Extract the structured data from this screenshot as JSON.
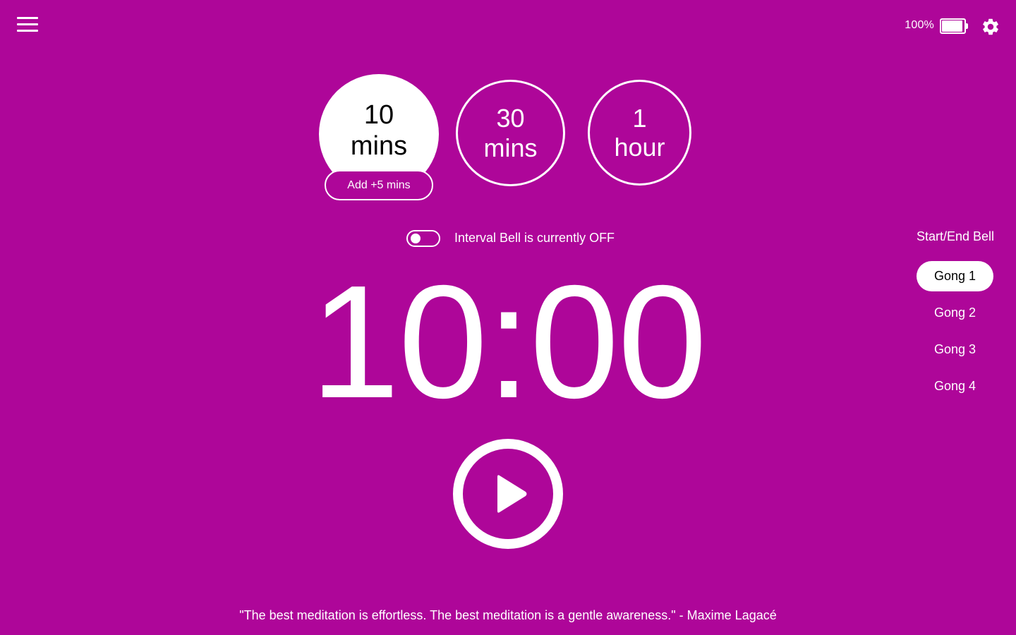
{
  "header": {
    "menu_icon": "hamburger-menu-icon",
    "battery_percent": "100%",
    "battery_level": 1.0,
    "battery_icon": "battery-icon",
    "settings_icon": "gear-icon"
  },
  "presets": [
    {
      "line1": "10",
      "line2": "mins",
      "selected": true
    },
    {
      "line1": "30",
      "line2": "mins",
      "selected": false
    },
    {
      "line1": "1",
      "line2": "hour",
      "selected": false
    }
  ],
  "add_button": {
    "label": "Add +5 mins"
  },
  "interval_bell": {
    "label": "Interval Bell is currently OFF",
    "enabled": false
  },
  "timer": {
    "display": "10:00"
  },
  "play_icon": "play-icon",
  "bell": {
    "title": "Start/End Bell",
    "options": [
      {
        "label": "Gong 1",
        "selected": true
      },
      {
        "label": "Gong 2",
        "selected": false
      },
      {
        "label": "Gong 3",
        "selected": false
      },
      {
        "label": "Gong 4",
        "selected": false
      }
    ]
  },
  "quote": "\"The best meditation is effortless. The best meditation is a gentle awareness.\" - Maxime Lagacé",
  "colors": {
    "background": "#ae0699",
    "foreground": "#ffffff",
    "selected_text": "#000000"
  }
}
